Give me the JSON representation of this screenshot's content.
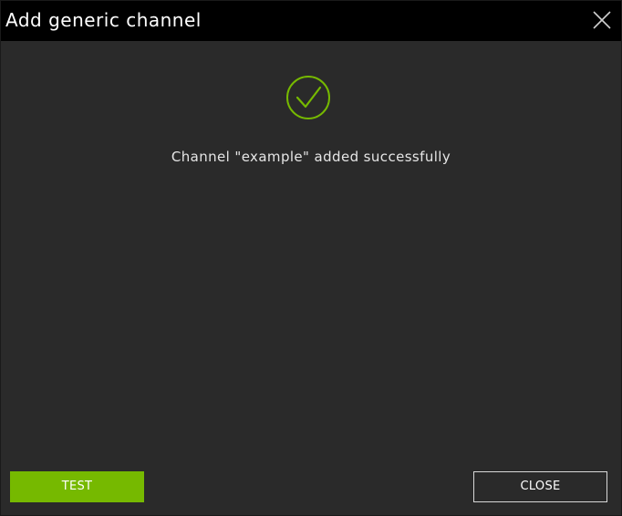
{
  "dialog": {
    "title": "Add generic channel",
    "close_icon": "close-x-icon"
  },
  "status": {
    "icon": "check-circle-icon",
    "message": "Channel \"example\" added successfully"
  },
  "actions": {
    "test_label": "TEST",
    "close_label": "CLOSE"
  },
  "colors": {
    "accent": "#76b900",
    "background": "#2a2a2a",
    "titlebar": "#000000"
  }
}
